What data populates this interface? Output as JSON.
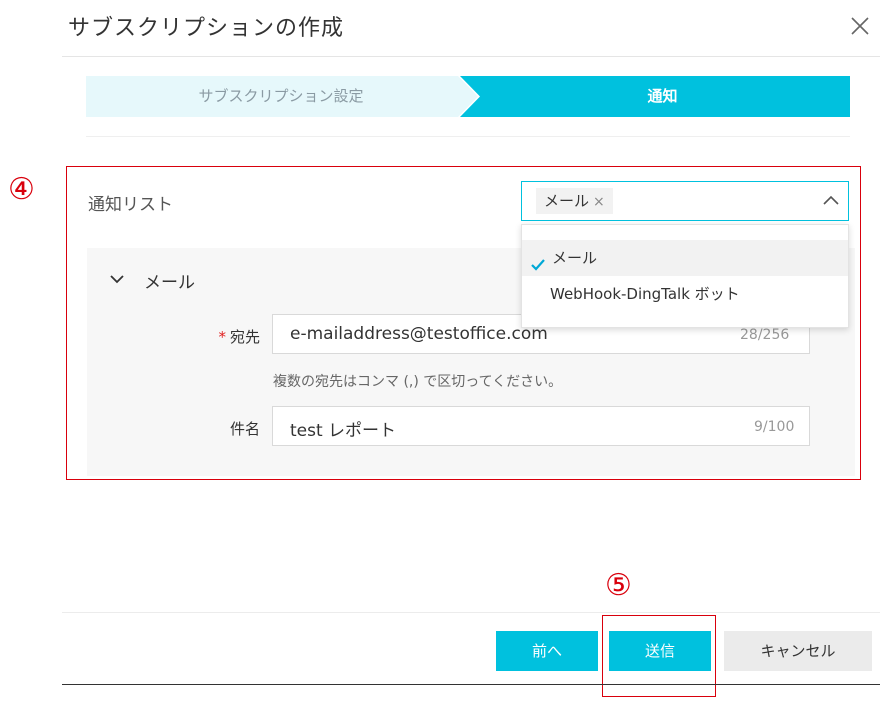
{
  "dialog": {
    "title": "サブスクリプションの作成"
  },
  "steps": [
    {
      "label": "サブスクリプション設定",
      "active": false
    },
    {
      "label": "通知",
      "active": true
    }
  ],
  "annotations": {
    "marker_4": "④",
    "marker_5": "⑤"
  },
  "notification_list": {
    "label": "通知リスト",
    "selected_tag": "メール",
    "tag_remove_icon": "×",
    "options": [
      {
        "label": "メール",
        "selected": true
      },
      {
        "label": "WebHook-DingTalk ボット",
        "selected": false
      }
    ]
  },
  "mail_section": {
    "title": "メール",
    "recipient": {
      "required_mark": "*",
      "label": "宛先",
      "value": "e-mailaddress@testoffice.com",
      "counter": "28/256",
      "hint": "複数の宛先はコンマ (,) で区切ってください。"
    },
    "subject": {
      "label": "件名",
      "value": "test レポート",
      "counter": "9/100"
    }
  },
  "footer": {
    "prev_label": "前へ",
    "submit_label": "送信",
    "cancel_label": "キャンセル"
  },
  "colors": {
    "accent": "#00c1de",
    "step_inactive_bg": "#e6f8fb",
    "annotation_red": "#d9000c"
  }
}
